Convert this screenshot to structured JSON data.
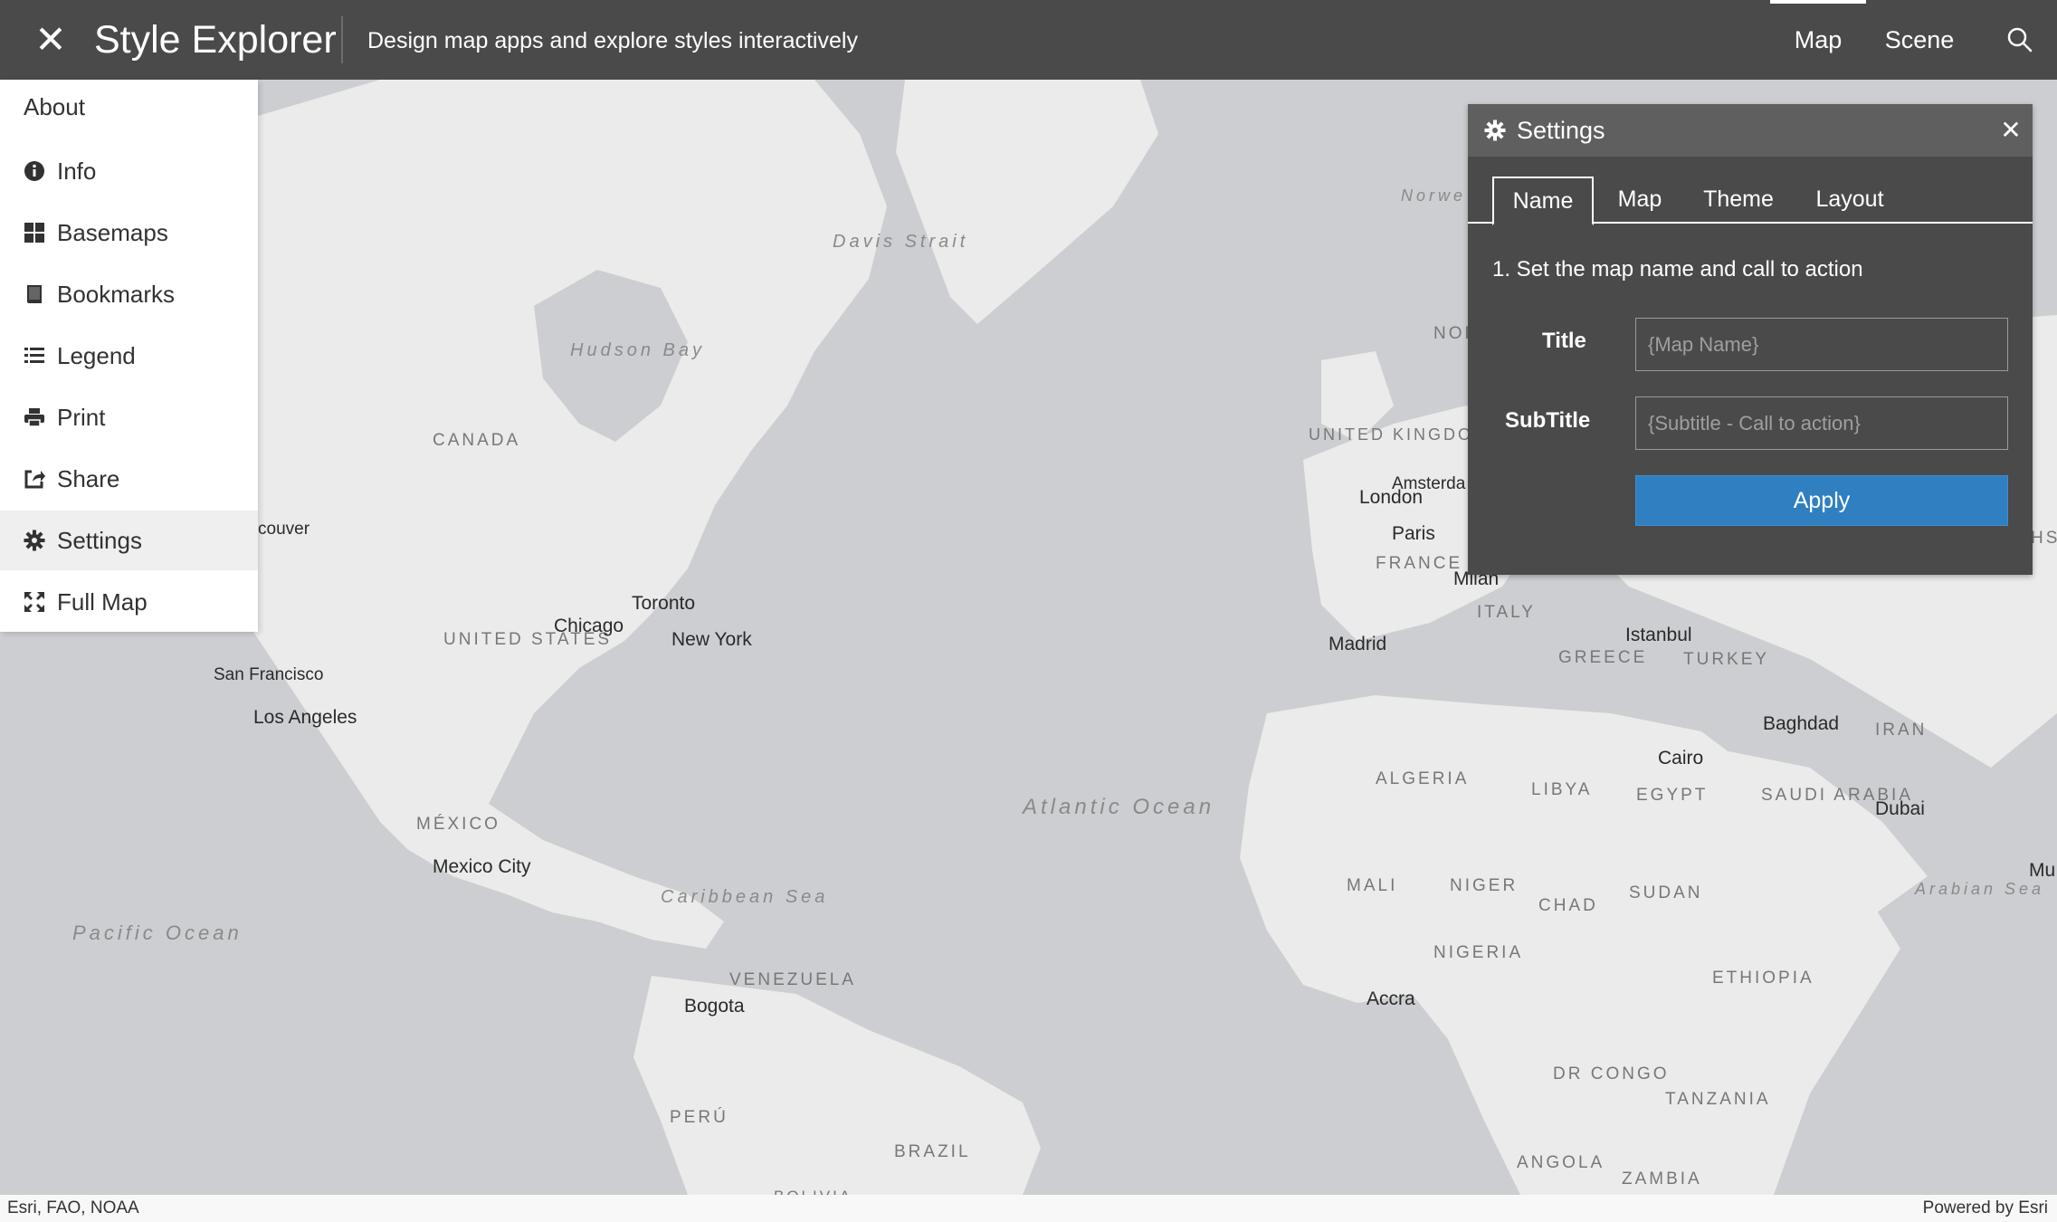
{
  "header": {
    "close_icon": "close-icon",
    "title": "Style Explorer",
    "subtitle": "Design map apps and explore styles interactively",
    "tabs": [
      {
        "label": "Map",
        "active": true
      },
      {
        "label": "Scene",
        "active": false
      }
    ],
    "search_icon": "search-icon"
  },
  "menu": {
    "about": "About",
    "items": [
      {
        "label": "Info",
        "icon": "info-icon"
      },
      {
        "label": "Basemaps",
        "icon": "grid-icon"
      },
      {
        "label": "Bookmarks",
        "icon": "bookmark-icon"
      },
      {
        "label": "Legend",
        "icon": "list-icon"
      },
      {
        "label": "Print",
        "icon": "print-icon"
      },
      {
        "label": "Share",
        "icon": "share-icon"
      },
      {
        "label": "Settings",
        "icon": "gear-icon",
        "active": true
      },
      {
        "label": "Full Map",
        "icon": "expand-icon"
      }
    ]
  },
  "settings": {
    "title": "Settings",
    "tabs": [
      "Name",
      "Map",
      "Theme",
      "Layout"
    ],
    "active_tab": "Name",
    "step": "1. Set the map name and call to action",
    "title_label": "Title",
    "title_placeholder": "{Map Name}",
    "subtitle_label": "SubTitle",
    "subtitle_placeholder": "{Subtitle - Call to action}",
    "apply_label": "Apply"
  },
  "map": {
    "labels": {
      "davis_strait": "Davis Strait",
      "hudson_bay": "Hudson Bay",
      "canada": "CANADA",
      "vancouver": "couver",
      "united_states": "UNITED STATES",
      "toronto": "Toronto",
      "chicago": "Chicago",
      "new_york": "New York",
      "san_francisco": "San Francisco",
      "los_angeles": "Los Angeles",
      "mexico": "MÉXICO",
      "mexico_city": "Mexico City",
      "caribbean": "Caribbean Sea",
      "pacific": "Pacific Ocean",
      "atlantic": "Atlantic Ocean",
      "venezuela": "VENEZUELA",
      "bogota": "Bogota",
      "peru": "PERÚ",
      "brazil": "BRAZIL",
      "bolivia": "BOLIVIA",
      "norwegian_sea": "Norwe Se",
      "nor": "NOR",
      "uk": "UNITED KINGDOM",
      "amsterdam": "Amsterda",
      "london": "London",
      "paris": "Paris",
      "france": "FRANCE",
      "milan": "Milan",
      "italy": "ITALY",
      "hs": "HS",
      "madrid": "Madrid",
      "istanbul": "Istanbul",
      "greece": "GREECE",
      "turkey": "TURKEY",
      "baghdad": "Baghdad",
      "iran": "IRAN",
      "cairo": "Cairo",
      "algeria": "ALGERIA",
      "libya": "LIBYA",
      "egypt": "EGYPT",
      "saudi": "SAUDI ARABIA",
      "dubai": "Dubai",
      "mu": "Mu",
      "mali": "MALI",
      "niger": "NIGER",
      "chad": "CHAD",
      "sudan": "SUDAN",
      "arabian_sea": "Arabian Sea",
      "nigeria": "NIGERIA",
      "ethiopia": "ETHIOPIA",
      "accra": "Accra",
      "dr_congo": "DR CONGO",
      "tanzania": "TANZANIA",
      "angola": "ANGOLA",
      "zambia": "ZAMBIA"
    }
  },
  "attribution": {
    "left": "Esri, FAO, NOAA",
    "right": "Powered by Esri"
  }
}
